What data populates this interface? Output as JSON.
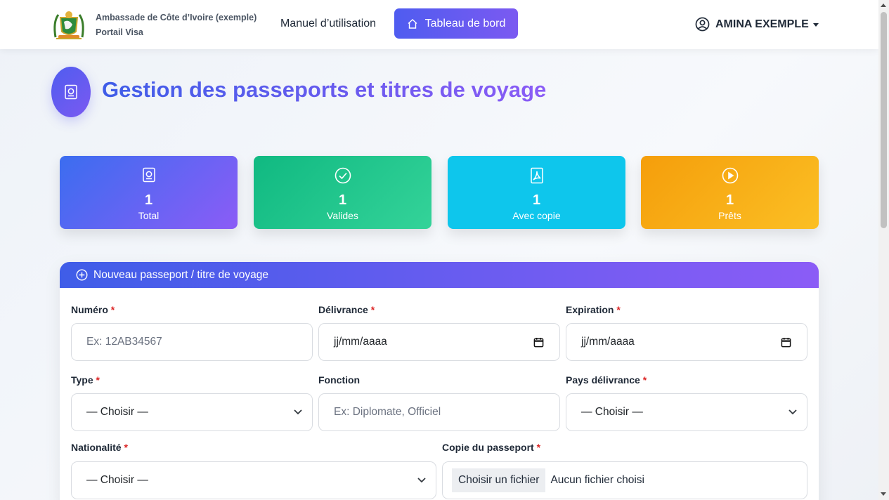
{
  "navbar": {
    "brand_line1": "Ambassade de Côte d’Ivoire (exemple)",
    "brand_line2": "Portail Visa",
    "manual_link": "Manuel d’utilisation",
    "dashboard_button": "Tableau de bord",
    "user_name": "AMINA EXEMPLE"
  },
  "header": {
    "title": "Gestion des passeports et titres de voyage"
  },
  "stats": [
    {
      "value": "1",
      "label": "Total",
      "icon": "passport-icon"
    },
    {
      "value": "1",
      "label": "Valides",
      "icon": "check-circle-icon"
    },
    {
      "value": "1",
      "label": "Avec copie",
      "icon": "pdf-file-icon"
    },
    {
      "value": "1",
      "label": "Prêts",
      "icon": "play-circle-icon"
    }
  ],
  "form": {
    "title": "Nouveau passeport / titre de voyage",
    "numero": {
      "label": "Numéro",
      "placeholder": "Ex: 12AB34567"
    },
    "delivrance": {
      "label": "Délivrance",
      "value": "jj/mm/aaaa"
    },
    "expiration": {
      "label": "Expiration",
      "value": "jj/mm/aaaa"
    },
    "type": {
      "label": "Type",
      "value": "— Choisir —"
    },
    "fonction": {
      "label": "Fonction",
      "placeholder": "Ex: Diplomate, Officiel"
    },
    "pays": {
      "label": "Pays délivrance",
      "value": "— Choisir —"
    },
    "nationalite": {
      "label": "Nationalité",
      "value": "— Choisir —"
    },
    "copie": {
      "label": "Copie du passeport",
      "button": "Choisir un fichier",
      "status": "Aucun fichier choisi"
    },
    "required_mark": "*"
  },
  "colors": {
    "primary": "#4f5cf0",
    "accent": "#8b5cf6",
    "success": "#10b981",
    "info": "#0ec6ec",
    "warning": "#f59e0b",
    "required": "#dc2626"
  }
}
